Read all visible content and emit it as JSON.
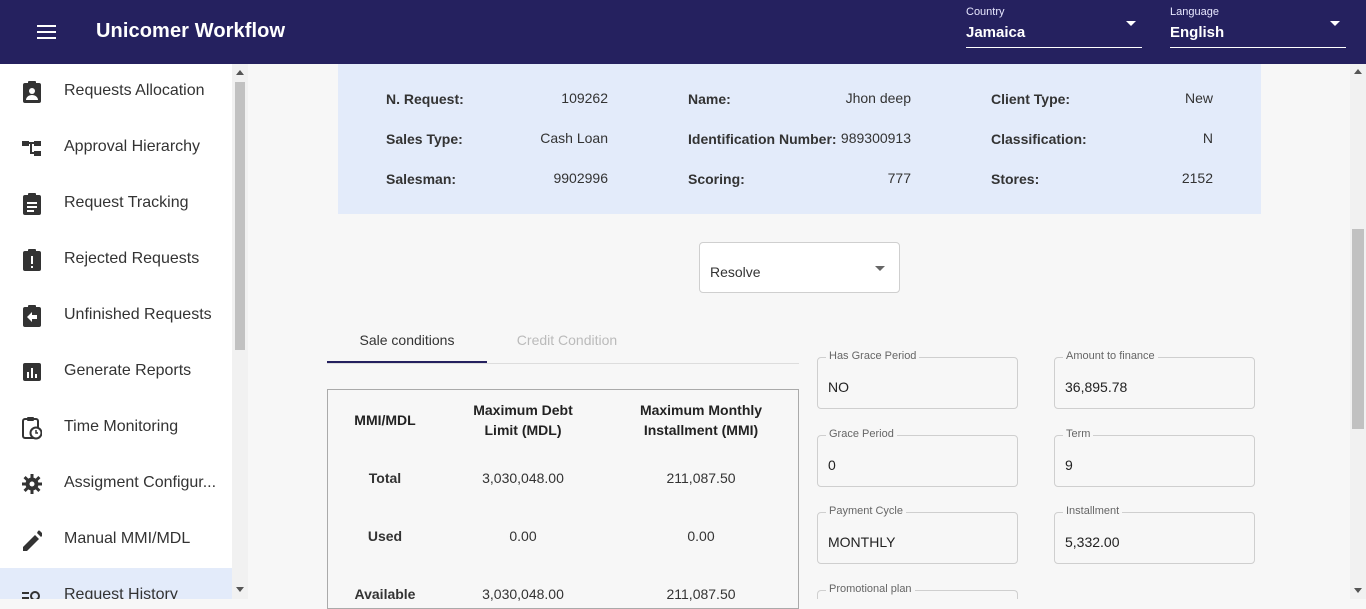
{
  "header": {
    "title": "Unicomer Workflow",
    "country": {
      "label": "Country",
      "value": "Jamaica"
    },
    "language": {
      "label": "Language",
      "value": "English"
    }
  },
  "sidebar": {
    "items": [
      {
        "label": "Requests Allocation",
        "icon": "assignment-ind-icon"
      },
      {
        "label": "Approval Hierarchy",
        "icon": "account-tree-icon"
      },
      {
        "label": "Request Tracking",
        "icon": "assignment-icon"
      },
      {
        "label": "Rejected Requests",
        "icon": "assignment-late-icon"
      },
      {
        "label": "Unfinished Requests",
        "icon": "assignment-return-icon"
      },
      {
        "label": "Generate Reports",
        "icon": "assessment-icon"
      },
      {
        "label": "Time Monitoring",
        "icon": "pending-actions-icon"
      },
      {
        "label": "Assigment Configur...",
        "icon": "settings-icon"
      },
      {
        "label": "Manual MMI/MDL",
        "icon": "edit-icon"
      },
      {
        "label": "Request History",
        "icon": "manage-search-icon"
      }
    ]
  },
  "request_info": {
    "n_request": {
      "label": "N. Request:",
      "value": "109262"
    },
    "name": {
      "label": "Name:",
      "value": "Jhon deep"
    },
    "client_type": {
      "label": "Client Type:",
      "value": "New"
    },
    "sales_type": {
      "label": "Sales Type:",
      "value": "Cash Loan"
    },
    "identification": {
      "label": "Identification Number:",
      "value": "989300913"
    },
    "classification": {
      "label": "Classification:",
      "value": "N"
    },
    "salesman": {
      "label": "Salesman:",
      "value": "9902996"
    },
    "scoring": {
      "label": "Scoring:",
      "value": "777"
    },
    "stores": {
      "label": "Stores:",
      "value": "2152"
    }
  },
  "action_select": {
    "value": "Resolve"
  },
  "tabs": [
    {
      "label": "Sale conditions",
      "active": true
    },
    {
      "label": "Credit Condition",
      "active": false
    }
  ],
  "mmi_table": {
    "headers": [
      "MMI/MDL",
      "Maximum Debt Limit (MDL)",
      "Maximum Monthly Installment (MMI)"
    ],
    "header_lines": {
      "col1": [
        "Maximum Debt",
        "Limit (MDL)"
      ],
      "col2": [
        "Maximum Monthly",
        "Installment (MMI)"
      ]
    },
    "rows": [
      {
        "label": "Total",
        "mdl": "3,030,048.00",
        "mmi": "211,087.50"
      },
      {
        "label": "Used",
        "mdl": "0.00",
        "mmi": "0.00"
      },
      {
        "label": "Available",
        "mdl": "3,030,048.00",
        "mmi": "211,087.50"
      }
    ]
  },
  "fields": {
    "has_grace_period": {
      "label": "Has Grace Period",
      "value": "NO"
    },
    "amount_to_finance": {
      "label": "Amount to finance",
      "value": "36,895.78"
    },
    "grace_period": {
      "label": "Grace Period",
      "value": "0"
    },
    "term": {
      "label": "Term",
      "value": "9"
    },
    "payment_cycle": {
      "label": "Payment Cycle",
      "value": "MONTHLY"
    },
    "installment": {
      "label": "Installment",
      "value": "5,332.00"
    },
    "promotional_plan": {
      "label": "Promotional plan",
      "value": ""
    }
  },
  "colors": {
    "primary": "#25215f",
    "info_bg": "#e3ebfa",
    "active_item_bg": "#e3ebfa"
  }
}
